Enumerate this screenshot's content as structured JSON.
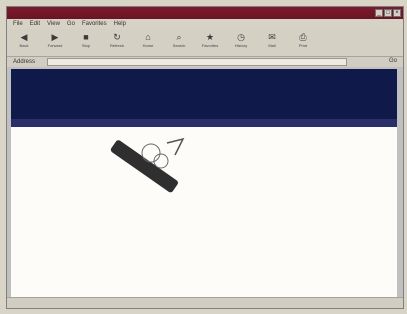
{
  "window": {
    "title": ""
  },
  "menu": [
    {
      "label": "File"
    },
    {
      "label": "Edit"
    },
    {
      "label": "View"
    },
    {
      "label": "Go"
    },
    {
      "label": "Favorites"
    },
    {
      "label": "Help"
    }
  ],
  "toolbar": [
    {
      "icon": "back-icon",
      "label": "Back"
    },
    {
      "icon": "forward-icon",
      "label": "Forward"
    },
    {
      "icon": "stop-icon",
      "label": "Stop"
    },
    {
      "icon": "refresh-icon",
      "label": "Refresh"
    },
    {
      "icon": "home-icon",
      "label": "Home"
    },
    {
      "icon": "search-icon",
      "label": "Search"
    },
    {
      "icon": "favorites-icon",
      "label": "Favorites"
    },
    {
      "icon": "history-icon",
      "label": "History"
    },
    {
      "icon": "mail-icon",
      "label": "Mail"
    },
    {
      "icon": "print-icon",
      "label": "Print"
    }
  ],
  "address": {
    "label": "Address",
    "value": "",
    "go_label": "Go"
  },
  "page": {
    "brand": "",
    "nav": [
      {
        "label": ""
      },
      {
        "label": ""
      },
      {
        "label": ""
      }
    ],
    "search_label": "",
    "sub_text": "",
    "side_text": "",
    "dots": "",
    "headline": "",
    "tagline": "",
    "section_label": "",
    "section_title": "",
    "body_text": ""
  },
  "status": {
    "text": ""
  }
}
